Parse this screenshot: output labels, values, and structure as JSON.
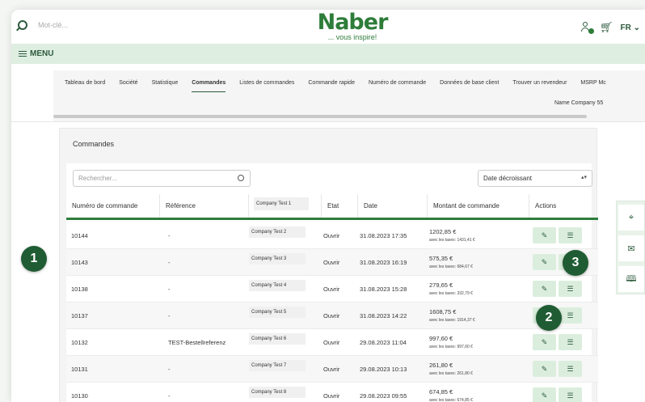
{
  "header": {
    "search_placeholder": "Mot-clé...",
    "logo_word": "Naber",
    "logo_tagline": "... vous inspire!",
    "language": "FR"
  },
  "menu": {
    "label": "MENU"
  },
  "nav": {
    "tabs": [
      "Tableau de bord",
      "Société",
      "Statistique",
      "Commandes",
      "Listes de commandes",
      "Commande rapide",
      "Numéro de commande",
      "Données de base client",
      "Trouver un revendeur",
      "MSRP Mc"
    ],
    "active_tab": "Commandes",
    "company_name": "Name Company 55"
  },
  "orders": {
    "title": "Commandes",
    "search_placeholder": "Rechercher...",
    "sort_value": "Date décroissant",
    "columns": {
      "number": "Numéro de commande",
      "reference": "Référence",
      "company": "Company Test 1",
      "status": "Etat",
      "date": "Date",
      "amount": "Montant de commande",
      "actions": "Actions"
    },
    "rows": [
      {
        "number": "10144",
        "reference": "-",
        "company": "Company Test 2",
        "status": "Ouvrir",
        "date": "31.08.2023 17:35",
        "amount": "1202,85 €",
        "tax": "avec les taxes: 1431,41 €"
      },
      {
        "number": "10143",
        "reference": "-",
        "company": "Company Test 3",
        "status": "Ouvrir",
        "date": "31.08.2023 16:19",
        "amount": "575,35 €",
        "tax": "avec les taxes: 684,67 €"
      },
      {
        "number": "10138",
        "reference": "-",
        "company": "Company Test 4",
        "status": "Ouvrir",
        "date": "31.08.2023 15:28",
        "amount": "279,65 €",
        "tax": "avec les taxes: 332,79 €"
      },
      {
        "number": "10137",
        "reference": "-",
        "company": "Company Test 5",
        "status": "Ouvrir",
        "date": "31.08.2023 14:22",
        "amount": "1608,75 €",
        "tax": "avec les taxes: 1914,37 €"
      },
      {
        "number": "10132",
        "reference": "TEST-Bestellreferenz",
        "company": "Company Test 6",
        "status": "Ouvrir",
        "date": "29.08.2023 11:04",
        "amount": "997,60 €",
        "tax": "avec les taxes: 997,60 €"
      },
      {
        "number": "10131",
        "reference": "-",
        "company": "Company Test 7",
        "status": "Ouvrir",
        "date": "29.08.2023 10:13",
        "amount": "261,80 €",
        "tax": "avec les taxes: 261,80 €"
      },
      {
        "number": "10130",
        "reference": "-",
        "company": "Company Test 8",
        "status": "Ouvrir",
        "date": "29.08.2023 09:55",
        "amount": "674,85 €",
        "tax": "avec les taxes: 674,85 €"
      }
    ]
  },
  "callouts": [
    "1",
    "2",
    "3"
  ],
  "icons": {
    "edit": "edit-icon",
    "list": "list-icon",
    "location": "location-pin-icon",
    "mail": "envelope-icon",
    "catalog": "book-icon"
  },
  "colors": {
    "brand": "#2e7d3a",
    "dark_green": "#1f5c33",
    "menu_bg": "#deeee0"
  }
}
